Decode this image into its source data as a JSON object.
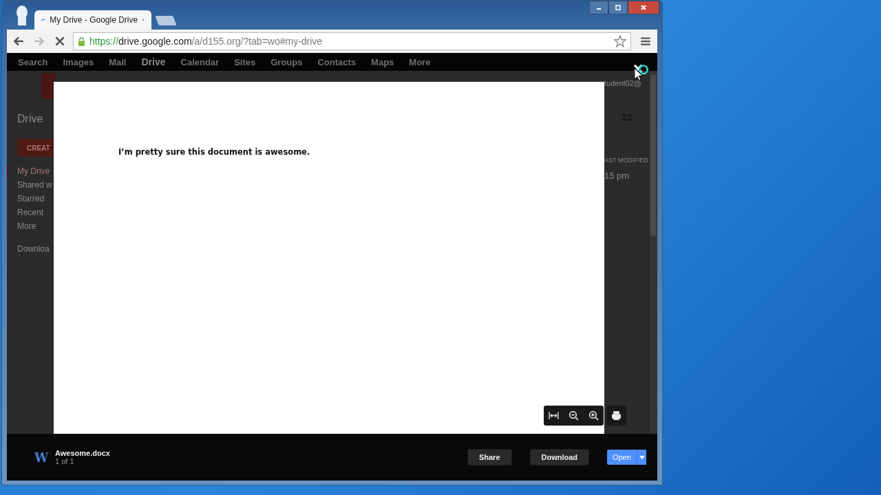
{
  "browser": {
    "tab_title": "My Drive - Google Drive",
    "loading": true,
    "url_scheme": "https://",
    "url_host": "drive.google.com",
    "url_path": "/a/d155.org/?tab=wo#my-drive"
  },
  "nav": [
    {
      "label": "Search",
      "selected": false
    },
    {
      "label": "Images",
      "selected": false
    },
    {
      "label": "Mail",
      "selected": false
    },
    {
      "label": "Drive",
      "selected": true
    },
    {
      "label": "Calendar",
      "selected": false
    },
    {
      "label": "Sites",
      "selected": false
    },
    {
      "label": "Groups",
      "selected": false
    },
    {
      "label": "Contacts",
      "selected": false
    },
    {
      "label": "Maps",
      "selected": false
    },
    {
      "label": "More",
      "selected": false
    }
  ],
  "sidebar": {
    "title": "Drive",
    "create_button": "CREAT",
    "items": [
      {
        "label": "My Drive",
        "selected": true
      },
      {
        "label": "Shared w",
        "selected": false
      },
      {
        "label": "Starred",
        "selected": false
      },
      {
        "label": "Recent",
        "selected": false
      },
      {
        "label": "More",
        "selected": false
      }
    ],
    "downloads": "Downloa"
  },
  "right_column": {
    "account": "tudent02@",
    "column_header": "AST MODIFIED",
    "modified": "15 pm"
  },
  "preview": {
    "text": "I’m pretty sure this document is awesome."
  },
  "footer": {
    "file_icon": "W",
    "file_name": "Awesome.docx",
    "position": "1 of 1",
    "buttons": [
      "Share",
      "Download"
    ],
    "open_button": "Open"
  }
}
